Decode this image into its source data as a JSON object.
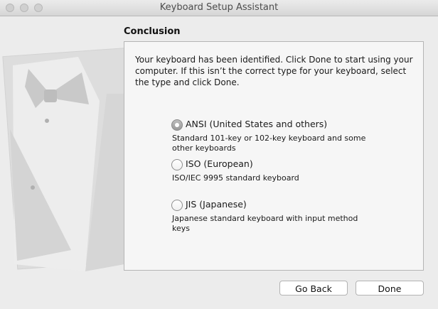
{
  "window": {
    "title": "Keyboard Setup Assistant"
  },
  "section": {
    "title": "Conclusion"
  },
  "intro": "Your keyboard has been identified. Click Done to start using your computer. If this isn’t the correct type for your keyboard, select the type and click Done.",
  "options": [
    {
      "label": "ANSI (United States and others)",
      "description": "Standard 101-key or 102-key keyboard and some other keyboards",
      "selected": true
    },
    {
      "label": "ISO (European)",
      "description": "ISO/IEC 9995 standard keyboard",
      "selected": false
    },
    {
      "label": "JIS (Japanese)",
      "description": "Japanese standard keyboard with input method keys",
      "selected": false
    }
  ],
  "buttons": {
    "back": "Go Back",
    "done": "Done"
  }
}
